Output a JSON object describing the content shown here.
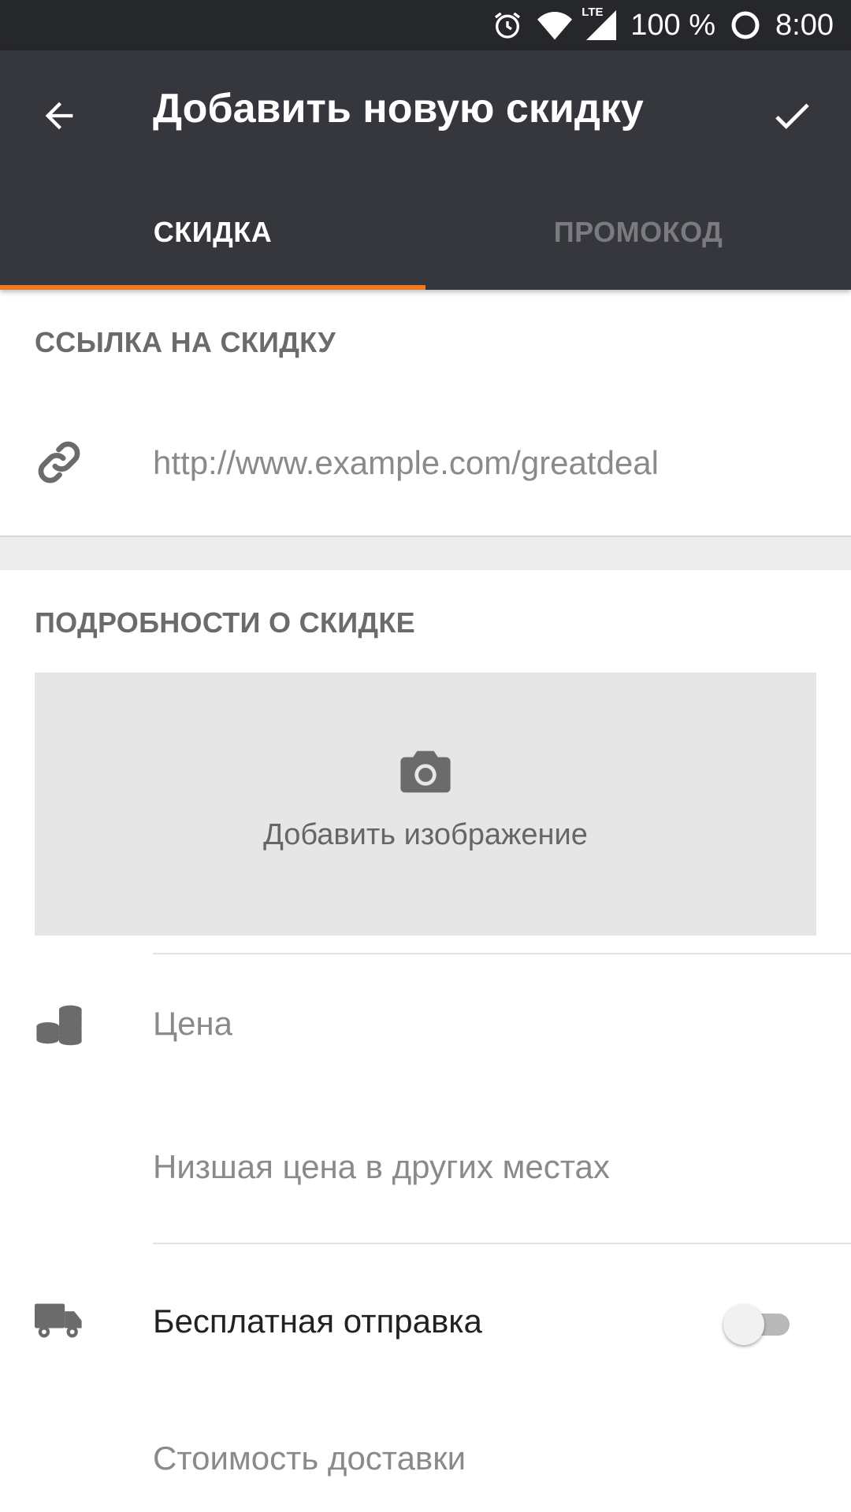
{
  "status_bar": {
    "network": "LTE",
    "battery": "100 %",
    "time": "8:00"
  },
  "toolbar": {
    "title": "Добавить новую скидку"
  },
  "tabs": [
    {
      "label": "СКИДКА",
      "active": true
    },
    {
      "label": "ПРОМОКОД",
      "active": false
    }
  ],
  "link_section": {
    "header": "ССЫЛКА НА СКИДКУ",
    "url_placeholder": "http://www.example.com/greatdeal"
  },
  "details_section": {
    "header": "ПОДРОБНОСТИ О СКИДКЕ",
    "add_image_label": "Добавить изображение",
    "price_placeholder": "Цена",
    "lower_price_placeholder": "Низшая цена в других местах",
    "free_shipping_label": "Бесплатная отправка",
    "free_shipping_enabled": false,
    "shipping_cost_placeholder": "Стоимость доставки"
  },
  "colors": {
    "status_bar": "#26272a",
    "app_bar": "#36373c",
    "accent": "#f07a22",
    "icon_gray": "#6b6b6b"
  }
}
